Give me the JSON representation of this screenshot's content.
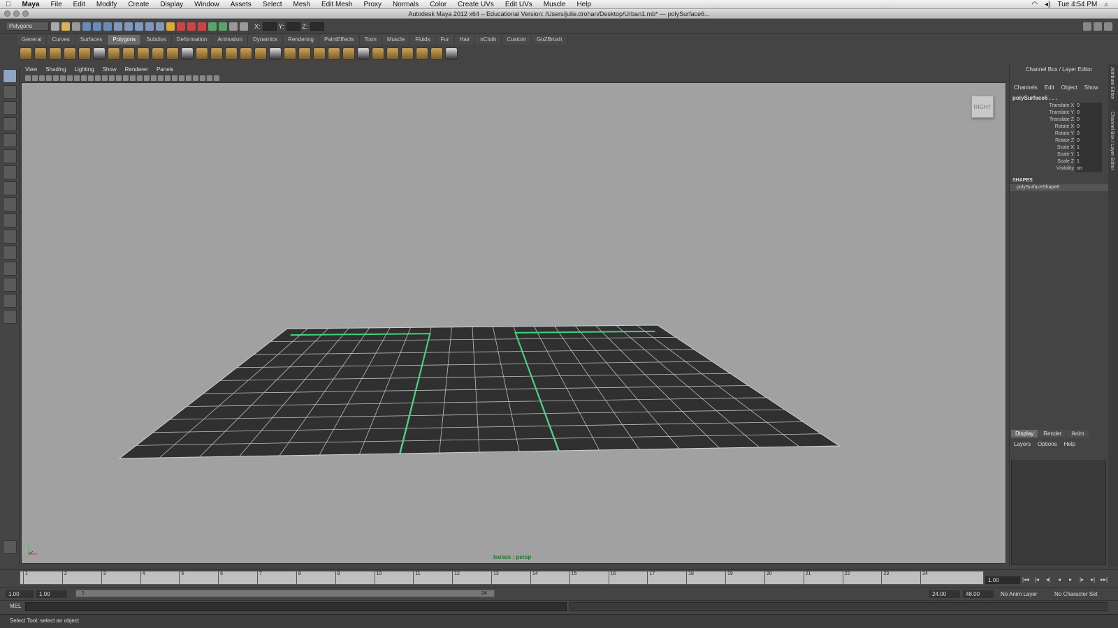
{
  "mac_menu": {
    "apple": "",
    "app": "Maya",
    "items": [
      "File",
      "Edit",
      "Modify",
      "Create",
      "Display",
      "Window",
      "Assets",
      "Select",
      "Mesh",
      "Edit Mesh",
      "Proxy",
      "Normals",
      "Color",
      "Create UVs",
      "Edit UVs",
      "Muscle",
      "Help"
    ],
    "clock": "Tue 4:54 PM"
  },
  "window_title": "Autodesk Maya 2012 x64 – Educational Version: /Users/julie.drohan/Desktop/Urban1.mb*   ---   polySurface6...",
  "statusline": {
    "menu_set": "Polygons",
    "x_label": "X:",
    "y_label": "Y:",
    "z_label": "Z:"
  },
  "shelf_tabs": [
    "General",
    "Curves",
    "Surfaces",
    "Polygons",
    "Subdivs",
    "Deformation",
    "Animation",
    "Dynamics",
    "Rendering",
    "PaintEffects",
    "Toon",
    "Muscle",
    "Fluids",
    "Fur",
    "Hair",
    "nCloth",
    "Custom",
    "GoZBrush"
  ],
  "active_shelf": "Polygons",
  "panel_menu": [
    "View",
    "Shading",
    "Lighting",
    "Show",
    "Renderer",
    "Panels"
  ],
  "viewport": {
    "view_cube_label": "RIGHT",
    "isolate_label": "Isolate : persp",
    "bg_color": "#a1a1a1",
    "mesh_color": "#303030",
    "selection_color": "#3fd47a"
  },
  "channel_box": {
    "title": "Channel Box / Layer Editor",
    "menu": [
      "Channels",
      "Edit",
      "Object",
      "Show"
    ],
    "object": "polySurface6 . . .",
    "channels": [
      {
        "name": "Translate X",
        "value": "0"
      },
      {
        "name": "Translate Y",
        "value": "0"
      },
      {
        "name": "Translate Z",
        "value": "0"
      },
      {
        "name": "Rotate X",
        "value": "0"
      },
      {
        "name": "Rotate Y",
        "value": "0"
      },
      {
        "name": "Rotate Z",
        "value": "0"
      },
      {
        "name": "Scale X",
        "value": "1"
      },
      {
        "name": "Scale Y",
        "value": "1"
      },
      {
        "name": "Scale Z",
        "value": "1"
      },
      {
        "name": "Visibility",
        "value": "on"
      }
    ],
    "shapes_label": "SHAPES",
    "shape_name": "polySurfaceShape6"
  },
  "layer_editor": {
    "tabs": [
      "Display",
      "Render",
      "Anim"
    ],
    "menu": [
      "Layers",
      "Options",
      "Help"
    ]
  },
  "side_tabs": [
    "Attribute Editor",
    "Channel Box / Layer Editor"
  ],
  "timeline": {
    "ticks": [
      "1",
      "2",
      "3",
      "4",
      "5",
      "6",
      "7",
      "8",
      "9",
      "10",
      "11",
      "12",
      "13",
      "14",
      "15",
      "16",
      "17",
      "18",
      "19",
      "20",
      "21",
      "22",
      "23",
      "24"
    ],
    "current_frame": "1.00"
  },
  "range": {
    "start": "1.00",
    "playback_start": "1.00",
    "slider_start": "1",
    "slider_end": "24",
    "playback_end": "24.00",
    "end": "48.00",
    "anim_layer": "No Anim Layer",
    "character_set": "No Character Set"
  },
  "mel_label": "MEL",
  "help_line": "Select Tool: select an object"
}
